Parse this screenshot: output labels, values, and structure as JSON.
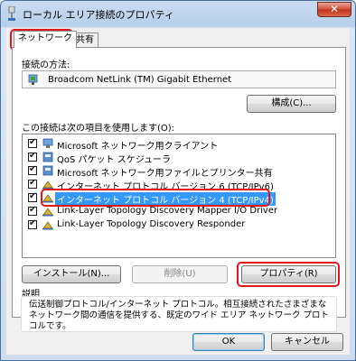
{
  "window": {
    "title": "ローカル エリア接続のプロパティ",
    "close_label": "✕"
  },
  "tabs": [
    {
      "label": "ネットワーク",
      "active": true
    },
    {
      "label": "共有",
      "active": false
    }
  ],
  "connect_using": {
    "label": "接続の方法:",
    "adapter": "Broadcom NetLink (TM) Gigabit Ethernet",
    "configure_button": "構成(C)..."
  },
  "items_section": {
    "label": "この接続は次の項目を使用します(O):",
    "items": [
      {
        "label": "Microsoft ネットワーク用クライアント",
        "checked": true,
        "icon": "client-icon",
        "selected": false
      },
      {
        "label": "QoS パケット スケジューラ",
        "checked": true,
        "icon": "service-icon",
        "selected": false
      },
      {
        "label": "Microsoft ネットワーク用ファイルとプリンター共有",
        "checked": true,
        "icon": "service-icon",
        "selected": false
      },
      {
        "label": "インターネット プロトコル バージョン 6 (TCP/IPv6)",
        "checked": true,
        "icon": "protocol-icon",
        "selected": false
      },
      {
        "label": "インターネット プロトコル バージョン 4 (TCP/IPv4)",
        "checked": true,
        "icon": "protocol-icon",
        "selected": true
      },
      {
        "label": "Link-Layer Topology Discovery Mapper I/O Driver",
        "checked": true,
        "icon": "protocol-icon",
        "selected": false
      },
      {
        "label": "Link-Layer Topology Discovery Responder",
        "checked": true,
        "icon": "protocol-icon",
        "selected": false
      }
    ]
  },
  "buttons": {
    "install": "インストール(N)...",
    "uninstall": "削除(U)",
    "properties": "プロパティ(R)",
    "ok": "OK",
    "cancel": "キャンセル"
  },
  "description": {
    "title": "説明",
    "text": "伝送制御プロトコル/インターネット プロトコル。相互接続されたさまざまなネットワーク間の通信を提供する、既定のワイド エリア ネットワーク プロトコルです。"
  },
  "colors": {
    "highlight": "#e0161d",
    "selection": "#3399ff"
  }
}
